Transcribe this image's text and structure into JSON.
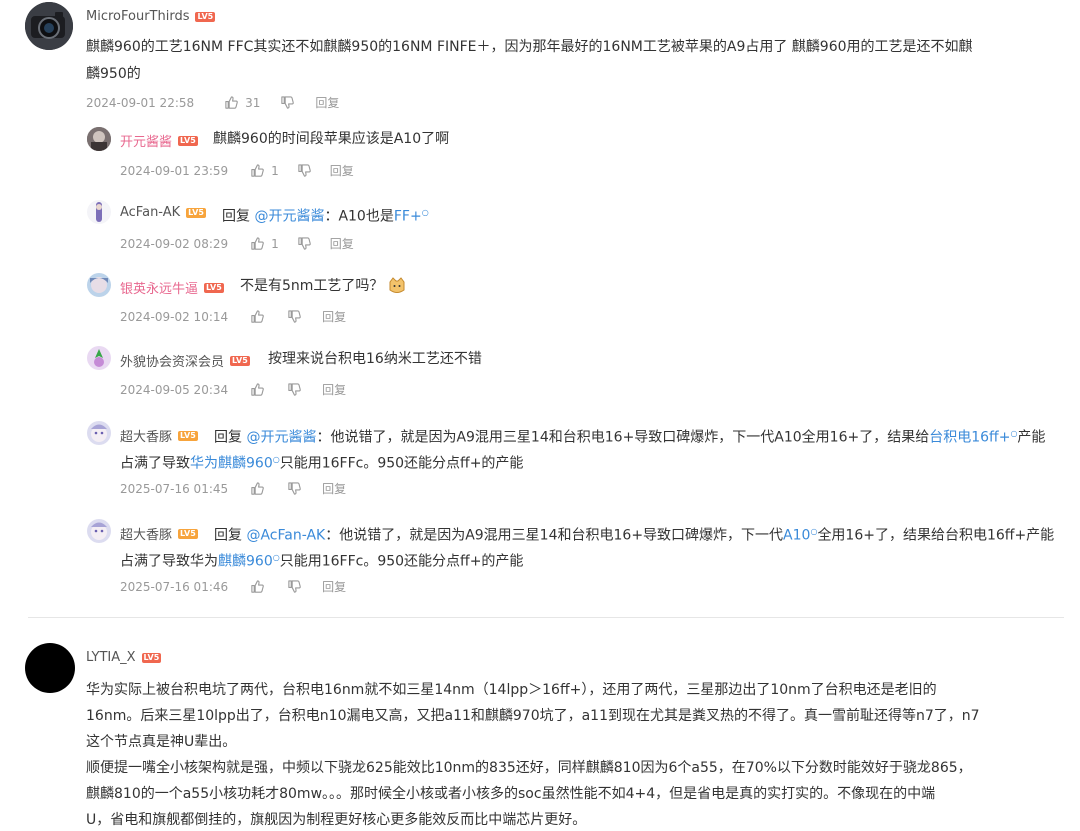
{
  "level_badge": "LV5",
  "reply_label": "回复",
  "reply_prefix": "回复",
  "comment1": {
    "username": "MicroFourThirds",
    "text_line1": "麒麟960的工艺16NM FFC其实还不如麒麟950的16NM FINFE＋，因为那年最好的16NM工艺被苹果的A9占用了 麒麟960用的工艺是还不如麒",
    "text_line2": "麟950的",
    "date": "2024-09-01 22:58",
    "likes": "31"
  },
  "replies": [
    {
      "username": "开元酱酱",
      "text": "麒麟960的时间段苹果应该是A10了啊",
      "date": "2024-09-01 23:59",
      "likes": "1"
    },
    {
      "username": "AcFan-AK",
      "mention": "@开元酱酱",
      "text": "：A10也是",
      "link": "FF+",
      "date": "2024-09-02 08:29",
      "likes": "1"
    },
    {
      "username": "银英永远牛逼",
      "text": "不是有5nm工艺了吗？",
      "date": "2024-09-02 10:14",
      "likes": ""
    },
    {
      "username": "外貌协会资深会员",
      "text": "按理来说台积电16纳米工艺还不错",
      "date": "2024-09-05 20:34",
      "likes": ""
    },
    {
      "username": "超大香豚",
      "mention": "@开元酱酱",
      "line1_a": "：他说错了，就是因为A9混用三星14和台积电16+导致口碑爆炸，下一代A10全用16+了，结果给",
      "line1_link": "台积电16ff+",
      "line1_b": "产能",
      "line2_a": "占满了导致",
      "line2_link": "华为麒麟960",
      "line2_b": "只能用16FFc。950还能分点ff+的产能",
      "date": "2025-07-16 01:45"
    },
    {
      "username": "超大香豚",
      "mention": "@AcFan-AK",
      "line1_a": "：他说错了，就是因为A9混用三星14和台积电16+导致口碑爆炸，下一代",
      "line1_link": "A10",
      "line1_b": "全用16+了，结果给台积电16ff+产能",
      "line2_a": "占满了导致华为",
      "line2_link": "麒麟960",
      "line2_b": "只能用16FFc。950还能分点ff+的产能",
      "date": "2025-07-16 01:46"
    }
  ],
  "comment2": {
    "username": "LYTIA_X",
    "lines": [
      "华为实际上被台积电坑了两代，台积电16nm就不如三星14nm（14lpp＞16ff+），还用了两代，三星那边出了10nm了台积电还是老旧的",
      "16nm。后来三星10lpp出了，台积电n10漏电又高，又把a11和麒麟970坑了，a11到现在尤其是粪叉热的不得了。真一雪前耻还得等n7了，n7",
      "这个节点真是神U辈出。",
      "顺便提一嘴全小核架构就是强，中频以下骁龙625能效比10nm的835还好，同样麒麟810因为6个a55，在70%以下分数时能效好于骁龙865，",
      "麒麟810的一个a55小核功耗才80mw。。。那时候全小核或者小核多的soc虽然性能不如4+4，但是省电是真的实打实的。不像现在的中端",
      "U，省电和旗舰都倒挂的，旗舰因为制程更好核心更多能效反而比中端芯片更好。"
    ]
  },
  "colors": {
    "link": "#3a8ad9",
    "pink_name": "#e8688f",
    "badge": "#f0674f",
    "meta": "#999999"
  }
}
